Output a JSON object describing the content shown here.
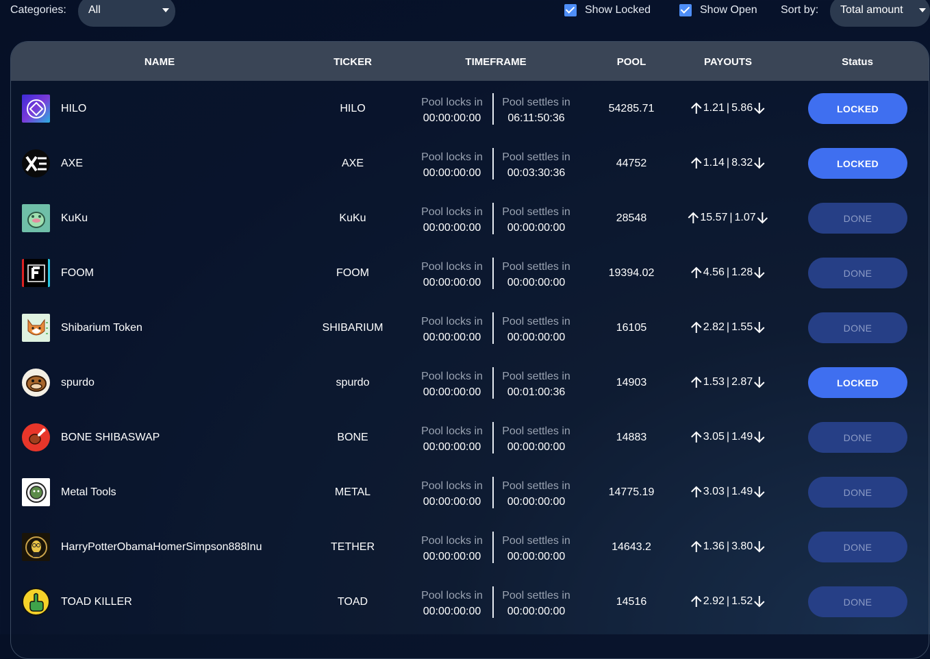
{
  "filters": {
    "categories_label": "Categories:",
    "categories_value": "All",
    "show_locked_label": "Show Locked",
    "show_open_label": "Show Open",
    "sort_label": "Sort by:",
    "sort_value": "Total amount"
  },
  "table": {
    "headers": {
      "name": "NAME",
      "ticker": "TICKER",
      "timeframe": "TIMEFRAME",
      "pool": "POOL",
      "payouts": "PAYOUTS",
      "status": "Status"
    },
    "rows": [
      {
        "name": "HILO",
        "ticker": "HILO",
        "locks_label": "Pool locks in",
        "locks": "00:00:00:00",
        "settles_label": "Pool settles in",
        "settles": "06:11:50:36",
        "pool": "54285.71",
        "up": "1.21",
        "down": "5.86",
        "status": "LOCKED",
        "logo": "hilo-logo"
      },
      {
        "name": "AXE",
        "ticker": "AXE",
        "locks_label": "Pool locks in",
        "locks": "00:00:00:00",
        "settles_label": "Pool settles in",
        "settles": "00:03:30:36",
        "pool": "44752",
        "up": "1.14",
        "down": "8.32",
        "status": "LOCKED",
        "logo": "axe-logo"
      },
      {
        "name": "KuKu",
        "ticker": "KuKu",
        "locks_label": "Pool locks in",
        "locks": "00:00:00:00",
        "settles_label": "Pool settles in",
        "settles": "00:00:00:00",
        "pool": "28548",
        "up": "15.57",
        "down": "1.07",
        "status": "DONE",
        "logo": "kuku-logo"
      },
      {
        "name": "FOOM",
        "ticker": "FOOM",
        "locks_label": "Pool locks in",
        "locks": "00:00:00:00",
        "settles_label": "Pool settles in",
        "settles": "00:00:00:00",
        "pool": "19394.02",
        "up": "4.56",
        "down": "1.28",
        "status": "DONE",
        "logo": "foom-logo"
      },
      {
        "name": "Shibarium Token",
        "ticker": "SHIBARIUM",
        "locks_label": "Pool locks in",
        "locks": "00:00:00:00",
        "settles_label": "Pool settles in",
        "settles": "00:00:00:00",
        "pool": "16105",
        "up": "2.82",
        "down": "1.55",
        "status": "DONE",
        "logo": "shibarium-logo"
      },
      {
        "name": "spurdo",
        "ticker": "spurdo",
        "locks_label": "Pool locks in",
        "locks": "00:00:00:00",
        "settles_label": "Pool settles in",
        "settles": "00:01:00:36",
        "pool": "14903",
        "up": "1.53",
        "down": "2.87",
        "status": "LOCKED",
        "logo": "spurdo-logo"
      },
      {
        "name": "BONE SHIBASWAP",
        "ticker": "BONE",
        "locks_label": "Pool locks in",
        "locks": "00:00:00:00",
        "settles_label": "Pool settles in",
        "settles": "00:00:00:00",
        "pool": "14883",
        "up": "3.05",
        "down": "1.49",
        "status": "DONE",
        "logo": "bone-logo"
      },
      {
        "name": "Metal Tools",
        "ticker": "METAL",
        "locks_label": "Pool locks in",
        "locks": "00:00:00:00",
        "settles_label": "Pool settles in",
        "settles": "00:00:00:00",
        "pool": "14775.19",
        "up": "3.03",
        "down": "1.49",
        "status": "DONE",
        "logo": "metal-logo"
      },
      {
        "name": "HarryPotterObamaHomerSimpson888Inu",
        "ticker": "TETHER",
        "locks_label": "Pool locks in",
        "locks": "00:00:00:00",
        "settles_label": "Pool settles in",
        "settles": "00:00:00:00",
        "pool": "14643.2",
        "up": "1.36",
        "down": "3.80",
        "status": "DONE",
        "logo": "hpohs-logo"
      },
      {
        "name": "TOAD KILLER",
        "ticker": "TOAD",
        "locks_label": "Pool locks in",
        "locks": "00:00:00:00",
        "settles_label": "Pool settles in",
        "settles": "00:00:00:00",
        "pool": "14516",
        "up": "2.92",
        "down": "1.52",
        "status": "DONE",
        "logo": "toad-logo"
      }
    ]
  },
  "colors": {
    "locked": "#3f6ff0",
    "done": "#263f86",
    "header": "#3a4556",
    "checkbox": "#4e8ef7"
  }
}
